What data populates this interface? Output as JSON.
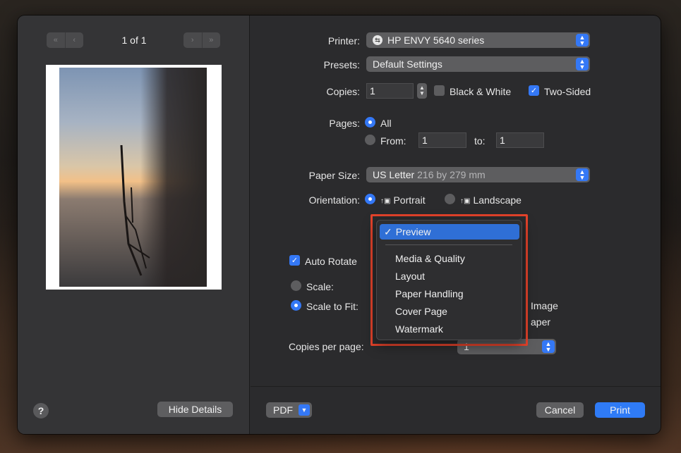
{
  "preview": {
    "page_count": "1 of 1",
    "nav_first": "«",
    "nav_prev": "‹",
    "nav_next": "›",
    "nav_last": "»",
    "hide_details_label": "Hide Details",
    "help_label": "?"
  },
  "printer": {
    "label": "Printer:",
    "value": "HP ENVY 5640 series"
  },
  "presets": {
    "label": "Presets:",
    "value": "Default Settings"
  },
  "copies": {
    "label": "Copies:",
    "value": "1",
    "black_white_label": "Black & White",
    "black_white_checked": false,
    "two_sided_label": "Two-Sided",
    "two_sided_checked": true
  },
  "pages": {
    "label": "Pages:",
    "all_label": "All",
    "from_label": "From:",
    "from_value": "1",
    "to_label": "to:",
    "to_value": "1"
  },
  "paper_size": {
    "label": "Paper Size:",
    "value": "US Letter",
    "detail": "216 by 279 mm"
  },
  "orientation": {
    "label": "Orientation:",
    "portrait_label": "Portrait",
    "landscape_label": "Landscape"
  },
  "section_menu": {
    "selected": "Preview",
    "items": [
      "Media & Quality",
      "Layout",
      "Paper Handling",
      "Cover Page",
      "Watermark"
    ]
  },
  "options": {
    "auto_rotate_label": "Auto Rotate",
    "scale_label": "Scale:",
    "scale_to_fit_label": "Scale to Fit:",
    "image_partial": "Image",
    "paper_partial": "aper",
    "copies_per_page_label": "Copies per page:",
    "copies_per_page_value": "1"
  },
  "footer": {
    "pdf_label": "PDF",
    "cancel_label": "Cancel",
    "print_label": "Print"
  },
  "colors": {
    "accent": "#3478f6",
    "highlight_border": "#e5432b",
    "window_bg": "#2b2b2d"
  }
}
